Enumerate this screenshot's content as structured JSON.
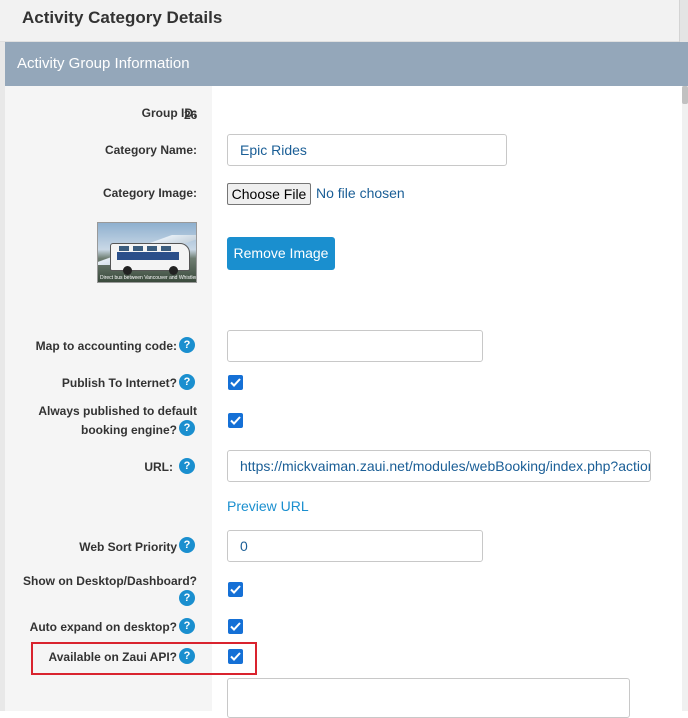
{
  "page": {
    "title": "Activity Category Details"
  },
  "section": {
    "title": "Activity Group Information"
  },
  "group_id": {
    "label": "Group ID:",
    "value": "26"
  },
  "category_name": {
    "label": "Category Name:",
    "value": "Epic Rides"
  },
  "category_image": {
    "label": "Category Image:",
    "choose_file": "Choose File",
    "no_file": "No file chosen",
    "remove_button": "Remove Image",
    "thumbnail_caption": "Direct bus between Vancouver and Whistler"
  },
  "accounting_code": {
    "label": "Map to accounting code:",
    "value": ""
  },
  "publish_internet": {
    "label": "Publish To Internet?",
    "checked": true
  },
  "always_published": {
    "label_line1": "Always published to default",
    "label_line2": "booking engine?",
    "checked": true
  },
  "url": {
    "label": "URL:",
    "value": "https://mickvaiman.zaui.net/modules/webBooking/index.php?action=C",
    "preview_link": "Preview URL"
  },
  "web_sort": {
    "label": "Web Sort Priority",
    "value": "0"
  },
  "show_desktop": {
    "label": "Show on Desktop/Dashboard?",
    "checked": true
  },
  "auto_expand": {
    "label": "Auto expand on desktop?",
    "checked": true
  },
  "zaui_api": {
    "label": "Available on Zaui API?",
    "checked": true
  },
  "help_glyph": "?",
  "colors": {
    "accent": "#1a8fcf",
    "section_header": "#94a7ba",
    "checkbox": "#1570d6",
    "highlight": "#d9232e"
  }
}
